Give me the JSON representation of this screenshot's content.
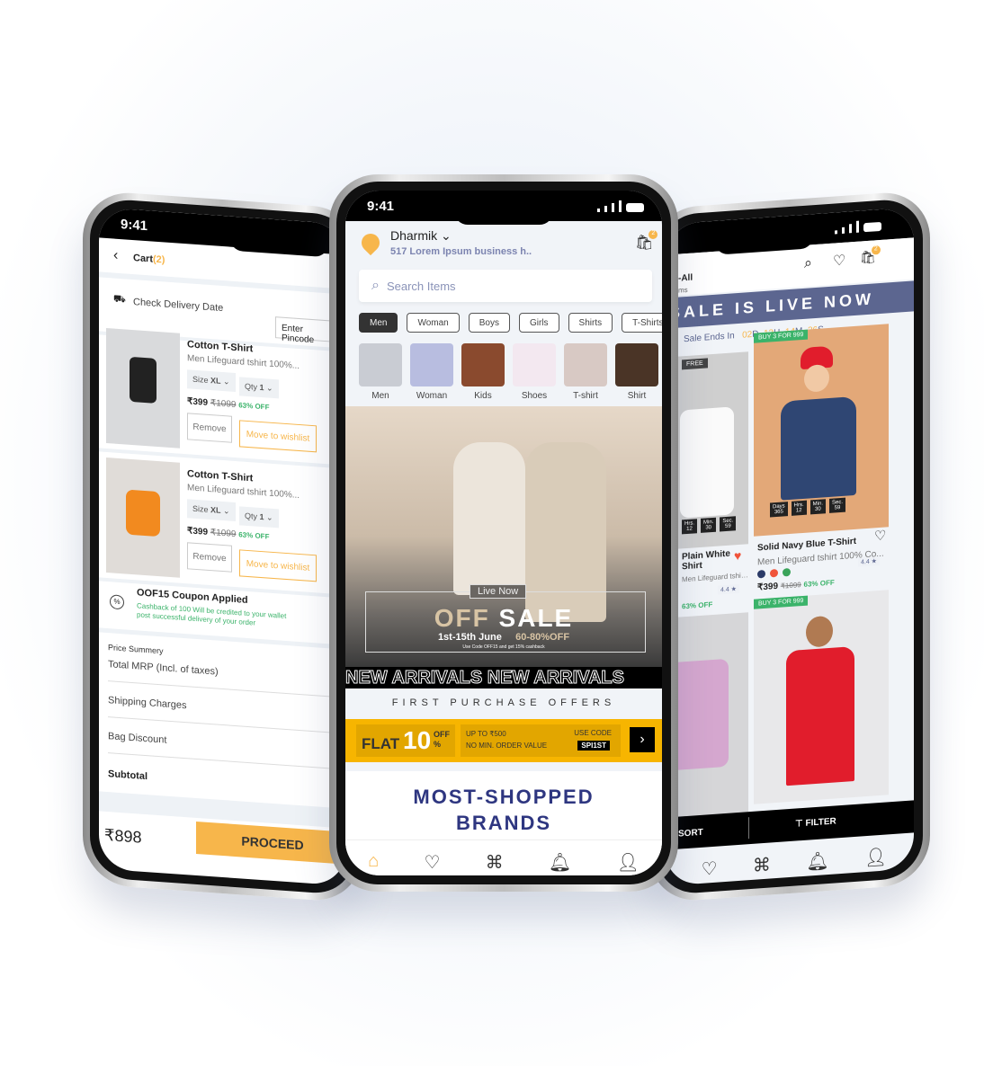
{
  "left_phone": {
    "time": "9:41",
    "title": "Cart",
    "count": "(2)",
    "delivery_label": "Check Delivery Date",
    "pincode_placeholder": "Enter Pincode",
    "items": [
      {
        "name": "Cotton T-Shirt",
        "desc": "Men Lifeguard tshirt 100%...",
        "size_label": "Size",
        "size": "XL",
        "qty_label": "Qty",
        "qty": "1",
        "price": "₹399",
        "mrp": "₹1099",
        "discount": "63% OFF",
        "remove": "Remove",
        "wishlist": "Move to wishlist",
        "photo_color": "#d9dadc"
      },
      {
        "name": "Cotton T-Shirt",
        "desc": "Men Lifeguard tshirt 100%...",
        "size_label": "Size",
        "size": "XL",
        "qty_label": "Qty",
        "qty": "1",
        "price": "₹399",
        "mrp": "₹1099",
        "discount": "63% OFF",
        "remove": "Remove",
        "wishlist": "Move to wishlist",
        "photo_color": "#e0dcd8"
      }
    ],
    "coupon_title": "OOF15 Coupon Applied",
    "coupon_text": "Cashback of  100 Will be credited to your wallet post successful delivery of your order",
    "summary_title": "Price Summery",
    "summary_rows": [
      "Total MRP (Incl. of taxes)",
      "Shipping Charges",
      "Bag Discount"
    ],
    "subtotal": "Subtotal",
    "total": "₹898",
    "proceed": "PROCEED"
  },
  "center_phone": {
    "time": "9:41",
    "user": "Dharmik",
    "address": "517 Lorem Ipsum business h..",
    "cart_badge": "2",
    "search_placeholder": "Search Items",
    "chips": [
      "Men",
      "Woman",
      "Boys",
      "Girls",
      "Shirts",
      "T-Shirts"
    ],
    "categories": [
      {
        "label": "Men",
        "color": "#c9ccd3"
      },
      {
        "label": "Woman",
        "color": "#b8bde0"
      },
      {
        "label": "Kids",
        "color": "#8a4a2e"
      },
      {
        "label": "Shoes",
        "color": "#f3e8f0"
      },
      {
        "label": "T-shirt",
        "color": "#d8c9c4"
      },
      {
        "label": "Shirt",
        "color": "#4a3426"
      }
    ],
    "banner": {
      "live": "Live Now",
      "off": "OFF",
      "sale": "SALE",
      "dates": "1st-15th June",
      "range": "60-80%OFF",
      "code_note": "Use Code OFF15 and get 15% cashback"
    },
    "marquee": "NEW ARRIVALS NEW ARRIVALS",
    "offers_title": "FIRST PURCHASE OFFERS",
    "offer": {
      "flat": "FLAT",
      "num": "10",
      "off": "OFF",
      "pct": "%",
      "line1": "UP TO ₹500",
      "line2": "NO MIN. ORDER VALUE",
      "use_code": "USE CODE",
      "code": "SPI1ST"
    },
    "brands_title": "MOST-SHOPPED BRANDS",
    "nav": [
      "home-icon",
      "heart-icon",
      "grid-icon",
      "bell-icon",
      "user-icon"
    ],
    "accent": "#f7b64b"
  },
  "right_phone": {
    "title": "Men-All",
    "subtitle": "36 Items",
    "cart_badge": "2",
    "sale_banner": "SALE IS LIVE NOW",
    "ends_label": "Sale Ends In",
    "timer": [
      "02",
      "D",
      "12",
      "H",
      "14",
      "M",
      "26",
      "S"
    ],
    "products": [
      {
        "badge": "FREE",
        "name": "Plain White Shirt",
        "desc": "Men Lifeguard tshirt 100%...",
        "rating": "4.4 ★",
        "discount": "63% OFF",
        "timer": [
          [
            "Hrs.",
            "12"
          ],
          [
            "Min.",
            "30"
          ],
          [
            "Sec.",
            "59"
          ]
        ],
        "photo_color": "#cfcfcf"
      },
      {
        "badge": "BUY 3 FOR 999",
        "name": "Solid Navy Blue T-Shirt",
        "desc": "Men Lifeguard tshirt 100% Co...",
        "rating": "4.4 ★",
        "price": "₹399",
        "mrp": "₹1099",
        "discount": "63% OFF",
        "timer": [
          [
            "Days",
            "365"
          ],
          [
            "Hrs.",
            "12"
          ],
          [
            "Min.",
            "30"
          ],
          [
            "Sec.",
            "59"
          ]
        ],
        "photo_color": "#e3a878"
      },
      {
        "photo_color": "#d6d6d8"
      },
      {
        "badge": "BUY 3 FOR 999",
        "photo_color": "#e8e8ea"
      }
    ],
    "sort": "SORT",
    "filter": "FILTER",
    "swatches": [
      "#2b3a67",
      "#f0533a",
      "#3aa35a"
    ]
  }
}
